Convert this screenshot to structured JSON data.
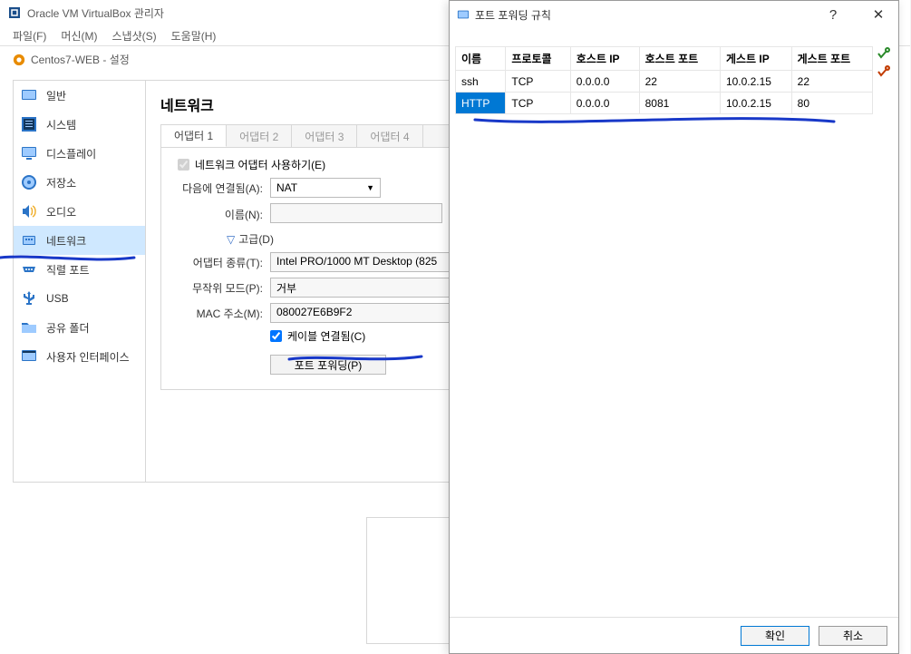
{
  "vm_window": {
    "title": "Oracle VM VirtualBox 관리자",
    "menubar": [
      "파일(F)",
      "머신(M)",
      "스냅샷(S)",
      "도움말(H)"
    ],
    "settings_title": "Centos7-WEB - 설정"
  },
  "categories": [
    {
      "id": "general",
      "label": "일반"
    },
    {
      "id": "system",
      "label": "시스템"
    },
    {
      "id": "display",
      "label": "디스플레이"
    },
    {
      "id": "storage",
      "label": "저장소"
    },
    {
      "id": "audio",
      "label": "오디오"
    },
    {
      "id": "network",
      "label": "네트워크",
      "selected": true
    },
    {
      "id": "serial",
      "label": "직렬 포트"
    },
    {
      "id": "usb",
      "label": "USB"
    },
    {
      "id": "shared",
      "label": "공유 폴더"
    },
    {
      "id": "ui",
      "label": "사용자 인터페이스"
    }
  ],
  "network": {
    "title": "네트워크",
    "tabs": [
      {
        "label": "어댑터 1",
        "active": true
      },
      {
        "label": "어댑터 2"
      },
      {
        "label": "어댑터 3"
      },
      {
        "label": "어댑터 4"
      }
    ],
    "enable_adapter_label": "네트워크 어댑터 사용하기(E)",
    "attached_label": "다음에 연결됨(A):",
    "attached_value": "NAT",
    "name_label": "이름(N):",
    "name_value": "",
    "advanced_label": "고급(D)",
    "adapter_type_label": "어댑터 종류(T):",
    "adapter_type_value": "Intel PRO/1000 MT Desktop (825",
    "promiscuous_label": "무작위 모드(P):",
    "promiscuous_value": "거부",
    "mac_label": "MAC 주소(M):",
    "mac_value": "080027E6B9F2",
    "cable_label": "케이블 연결됨(C)",
    "port_forward_btn": "포트 포워딩(P)"
  },
  "pf_dialog": {
    "title": "포트 포워딩 규칙",
    "help_glyph": "?",
    "close_glyph": "✕",
    "columns": [
      "이름",
      "프로토콜",
      "호스트 IP",
      "호스트 포트",
      "게스트 IP",
      "게스트 포트"
    ],
    "rows": [
      {
        "name": "ssh",
        "proto": "TCP",
        "hostip": "0.0.0.0",
        "hostport": "22",
        "guestip": "10.0.2.15",
        "guestport": "22"
      },
      {
        "name": "HTTP",
        "proto": "TCP",
        "hostip": "0.0.0.0",
        "hostport": "8081",
        "guestip": "10.0.2.15",
        "guestport": "80",
        "selected": true
      }
    ],
    "ok_label": "확인",
    "cancel_label": "취소"
  }
}
